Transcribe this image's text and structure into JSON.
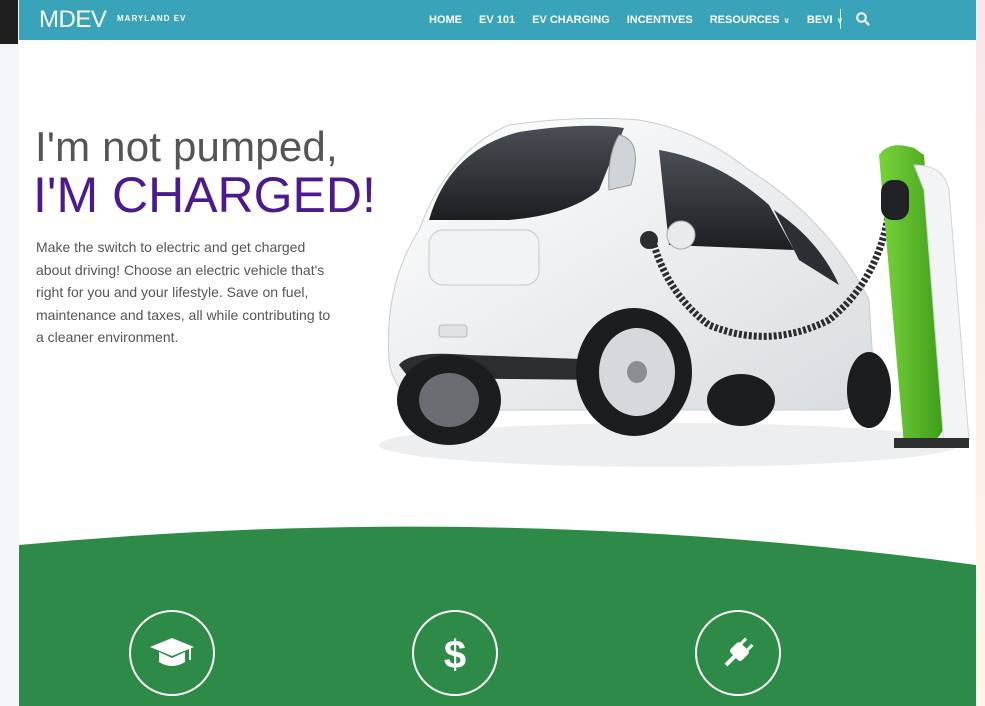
{
  "brand": {
    "logo": "MDEV",
    "subtitle": "MARYLAND EV"
  },
  "nav": {
    "items": [
      {
        "label": "HOME",
        "dropdown": false
      },
      {
        "label": "EV 101",
        "dropdown": false
      },
      {
        "label": "EV CHARGING",
        "dropdown": false
      },
      {
        "label": "INCENTIVES",
        "dropdown": false
      },
      {
        "label": "RESOURCES",
        "dropdown": true
      },
      {
        "label": "BEVI",
        "dropdown": true
      }
    ],
    "search_icon": "search-icon"
  },
  "hero": {
    "headline_line1": "I'm not pumped,",
    "headline_line2": "I'M CHARGED!",
    "body": "Make the switch to electric and get charged about driving! Choose an electric vehicle that's right for you and your lifestyle. Save on fuel, maintenance and taxes, all while contributing to a cleaner environment."
  },
  "features": [
    {
      "icon": "graduation-cap-icon"
    },
    {
      "icon": "dollar-icon"
    },
    {
      "icon": "plug-icon"
    }
  ],
  "colors": {
    "nav_bg": "#39a3ba",
    "headline_purple": "#4b1a8e",
    "band_green": "#2e8b47",
    "charger_green": "#5cc02a"
  }
}
